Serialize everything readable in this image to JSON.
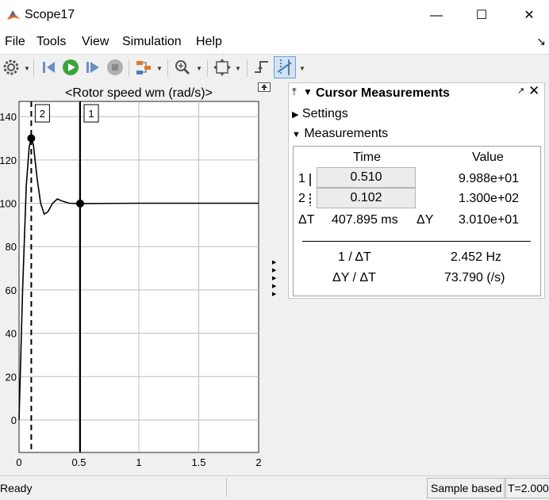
{
  "window": {
    "title": "Scope17"
  },
  "menu": {
    "file": "File",
    "tools": "Tools",
    "view": "View",
    "simulation": "Simulation",
    "help": "Help"
  },
  "chart_data": {
    "type": "line",
    "title": "<Rotor speed wm (rad/s)>",
    "xlim": [
      0,
      2
    ],
    "ylim": [
      -15,
      147
    ],
    "x_ticks": [
      "0",
      "0.5",
      "1",
      "1.5",
      "2"
    ],
    "y_ticks": [
      "0",
      "20",
      "40",
      "60",
      "80",
      "100",
      "120",
      "140"
    ],
    "grid": true,
    "series": [
      {
        "values": [
          [
            0,
            0
          ],
          [
            0.03,
            60
          ],
          [
            0.06,
            108
          ],
          [
            0.085,
            126
          ],
          [
            0.102,
            130
          ],
          [
            0.12,
            127
          ],
          [
            0.15,
            112
          ],
          [
            0.18,
            100
          ],
          [
            0.21,
            95
          ],
          [
            0.24,
            96
          ],
          [
            0.28,
            100
          ],
          [
            0.32,
            102
          ],
          [
            0.36,
            101
          ],
          [
            0.42,
            100
          ],
          [
            0.51,
            99.88
          ],
          [
            1.0,
            100
          ],
          [
            2.0,
            100
          ]
        ]
      }
    ],
    "cursors": [
      {
        "label": "1",
        "x": 0.51,
        "y": 99.88,
        "style": "solid"
      },
      {
        "label": "2",
        "x": 0.102,
        "y": 130.0,
        "style": "dashed"
      }
    ]
  },
  "cursor_panel": {
    "title": "Cursor Measurements",
    "settings_label": "Settings",
    "measurements_label": "Measurements",
    "col_time": "Time",
    "col_value": "Value",
    "rows": [
      {
        "index": "1",
        "time": "0.510",
        "value": "9.988e+01"
      },
      {
        "index": "2",
        "time": "0.102",
        "value": "1.300e+02"
      }
    ],
    "delta_t_label": "ΔT",
    "delta_t": "407.895 ms",
    "delta_y_label": "ΔY",
    "delta_y": "3.010e+01",
    "inv_dt_label": "1 / ΔT",
    "inv_dt": "2.452 Hz",
    "dy_dt_label": "ΔY / ΔT",
    "dy_dt": "73.790 (/s)"
  },
  "status": {
    "ready": "Ready",
    "sample": "Sample based",
    "time": "T=2.000"
  }
}
